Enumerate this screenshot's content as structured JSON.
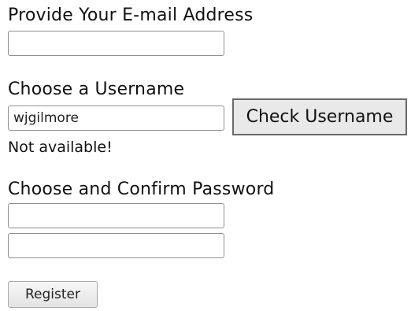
{
  "email": {
    "label": "Provide Your E-mail Address",
    "value": ""
  },
  "username": {
    "label": "Choose a Username",
    "value": "wjgilmore",
    "check_label": "Check Username",
    "status": "Not available!"
  },
  "password": {
    "label": "Choose and Confirm Password",
    "value": "",
    "confirm_value": ""
  },
  "register_label": "Register"
}
